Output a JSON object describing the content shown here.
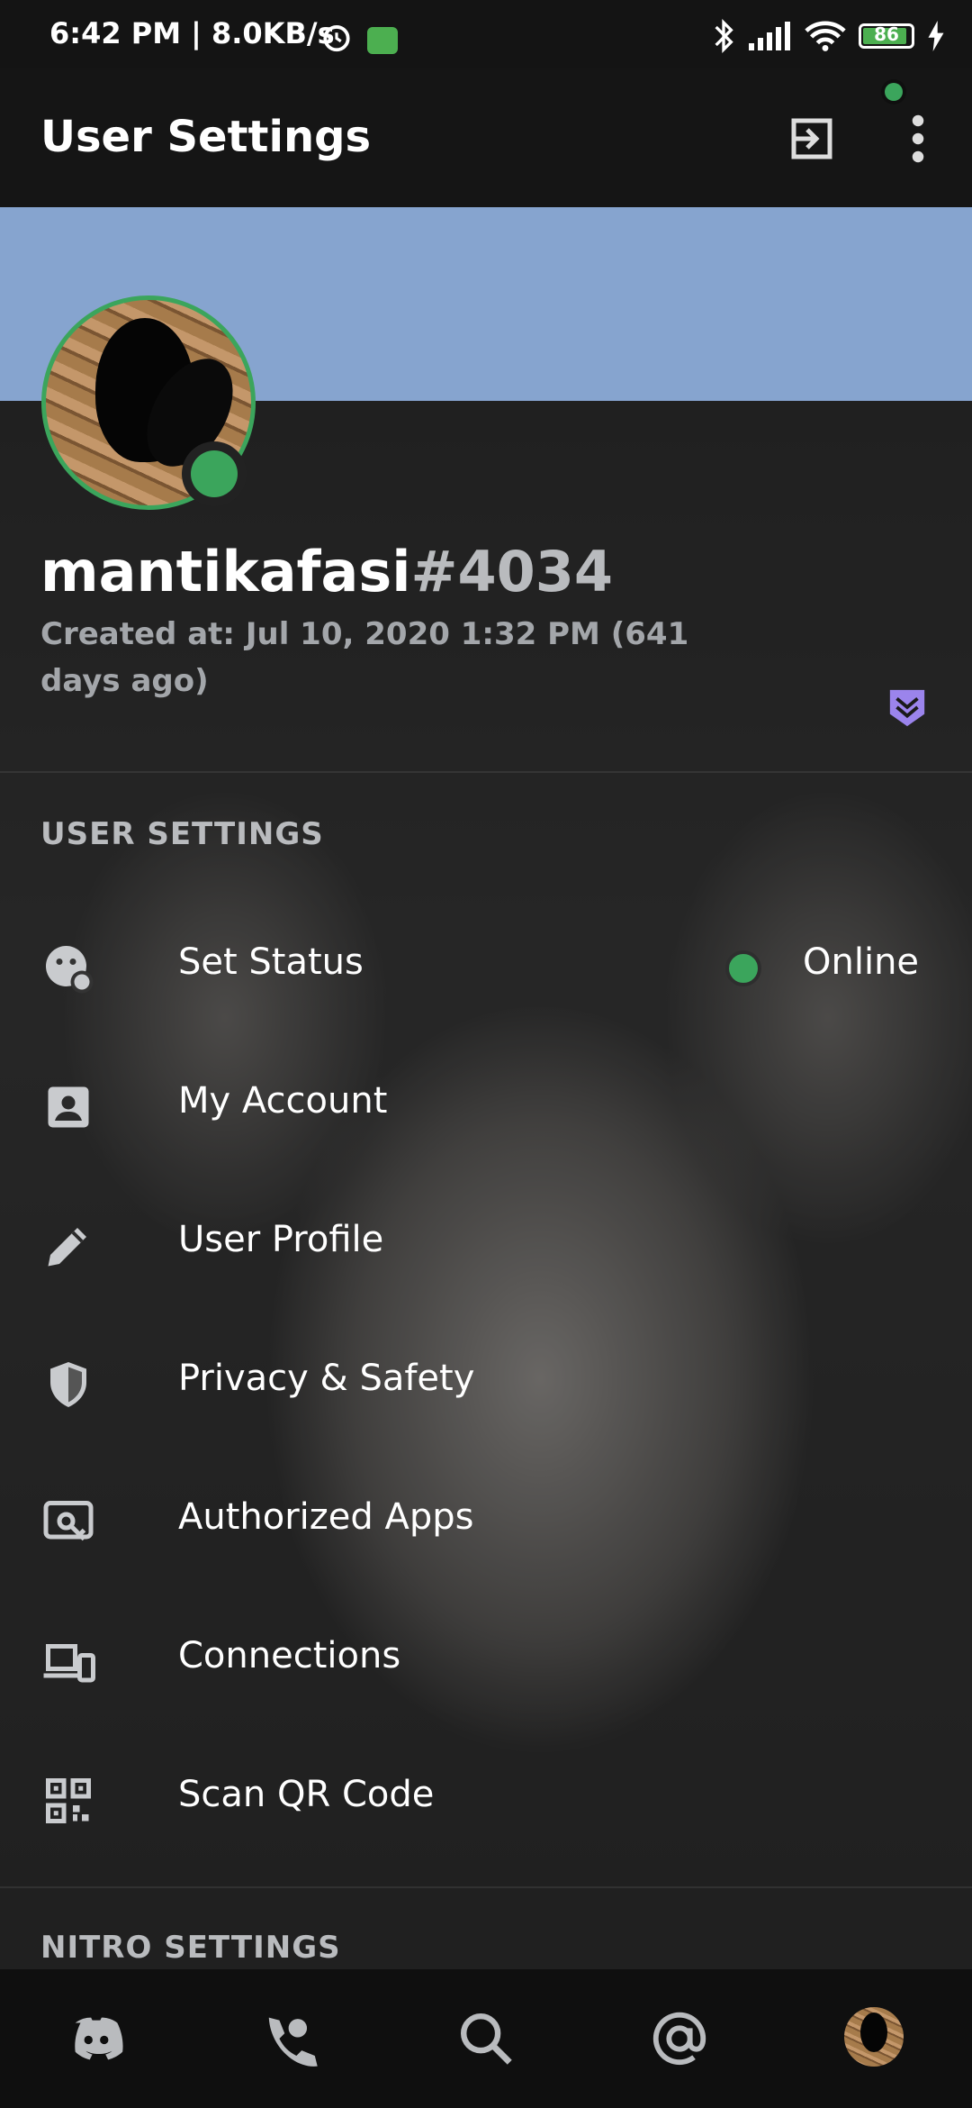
{
  "status_bar": {
    "time_text": "6:42 PM | 8.0KB/s",
    "battery_level": "86"
  },
  "app_bar": {
    "title": "User Settings"
  },
  "profile": {
    "banner_color": "#86a4cf",
    "username": "mantikafasi",
    "discriminator": "#4034",
    "created_at": "Created at: Jul 10, 2020 1:32 PM (641 days ago)",
    "presence_color": "#3ba55c"
  },
  "user_settings": {
    "header": "USER SETTINGS",
    "items": [
      {
        "label": "Set Status",
        "icon": "status-face-icon",
        "value": "Online"
      },
      {
        "label": "My Account",
        "icon": "account-card-icon"
      },
      {
        "label": "User Profile",
        "icon": "pencil-icon"
      },
      {
        "label": "Privacy & Safety",
        "icon": "shield-icon"
      },
      {
        "label": "Authorized Apps",
        "icon": "authorized-apps-icon"
      },
      {
        "label": "Connections",
        "icon": "devices-icon"
      },
      {
        "label": "Scan QR Code",
        "icon": "qr-code-icon"
      }
    ]
  },
  "nitro_settings": {
    "header": "NITRO SETTINGS"
  },
  "bottom_nav": [
    "discord-home-icon",
    "friends-icon",
    "search-icon",
    "mentions-icon",
    "profile-avatar"
  ]
}
